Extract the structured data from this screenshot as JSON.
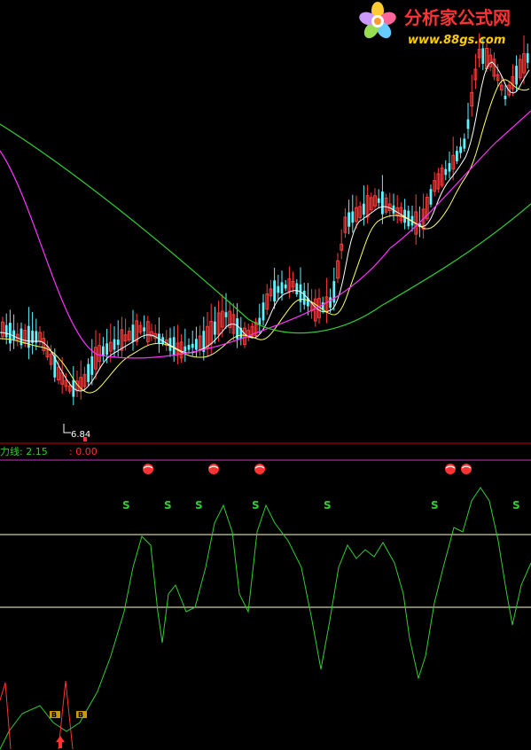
{
  "brand": {
    "title": "分析家公式网",
    "url": "www.88gs.com"
  },
  "price_panel": {
    "low_marker": "6.84",
    "colors": {
      "up": "#ff3b3b",
      "down": "#5ff2ff",
      "ma_short": "#ffffff",
      "ma_mid": "#ffff66",
      "ma_long": "#ff33ff",
      "ma_slow": "#33cc33"
    }
  },
  "indicator_panel": {
    "name": "力线: 2.15",
    "value2": ": 0.00",
    "upper_level": 80,
    "lower_level": 30,
    "s_label": "S",
    "buy_label": "B",
    "colors": {
      "line": "#33cc33",
      "levels": "#ffffcc",
      "red": "#ff3333",
      "s": "#33cc33"
    }
  },
  "chart_data": [
    {
      "type": "candlestick",
      "title": "",
      "low_annotation": "6.84",
      "series": [
        {
          "name": "",
          "values": []
        }
      ]
    },
    {
      "type": "line",
      "title": "力线",
      "current_value": 2.15,
      "secondary_value": 0.0,
      "reference_lines": [
        80,
        30
      ],
      "s_markers_count": 7,
      "ball_markers_count": 5
    }
  ]
}
